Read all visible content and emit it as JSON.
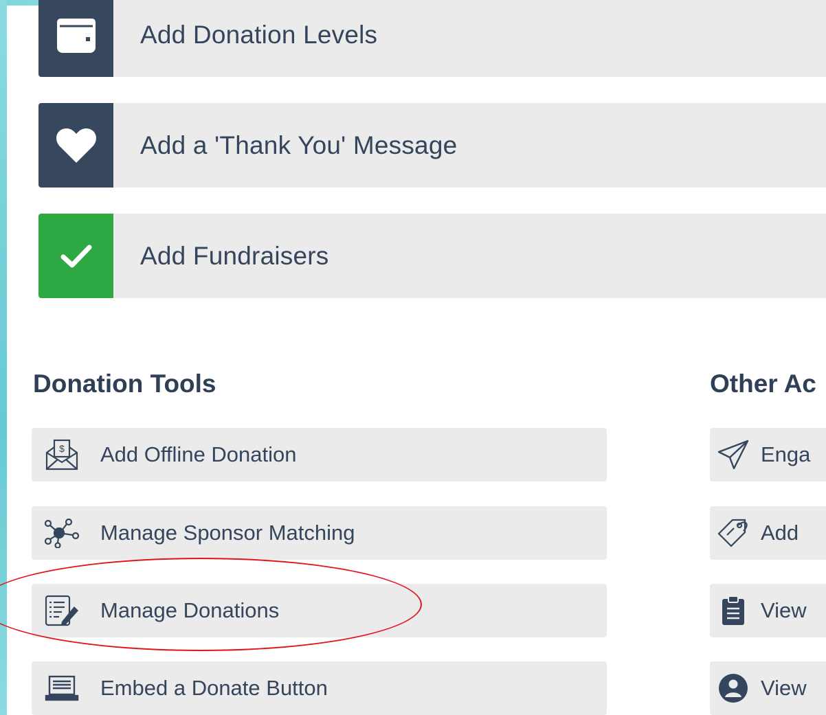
{
  "steps": [
    {
      "label": "Add Donation Levels",
      "icon": "wallet-icon",
      "status": "incomplete"
    },
    {
      "label": "Add a 'Thank You' Message",
      "icon": "heart-icon",
      "status": "incomplete"
    },
    {
      "label": "Add Fundraisers",
      "icon": "checkmark-icon",
      "status": "complete"
    }
  ],
  "donation_tools": {
    "title": "Donation Tools",
    "items": [
      {
        "label": "Add Offline Donation",
        "icon": "envelope-dollar-icon"
      },
      {
        "label": "Manage Sponsor Matching",
        "icon": "network-icon"
      },
      {
        "label": "Manage Donations",
        "icon": "list-edit-icon"
      },
      {
        "label": "Embed a Donate Button",
        "icon": "laptop-icon"
      }
    ]
  },
  "other_actions": {
    "title": "Other Ac",
    "items": [
      {
        "label": "Enga",
        "icon": "paper-plane-icon"
      },
      {
        "label": "Add",
        "icon": "tag-icon"
      },
      {
        "label": "View",
        "icon": "clipboard-icon"
      },
      {
        "label": "View",
        "icon": "user-circle-icon"
      }
    ]
  },
  "colors": {
    "dark_icon_bg": "#36475e",
    "complete_icon_bg": "#2ea843",
    "row_bg": "#ebebeb",
    "text": "#34455c",
    "annotation": "#e0161b"
  }
}
